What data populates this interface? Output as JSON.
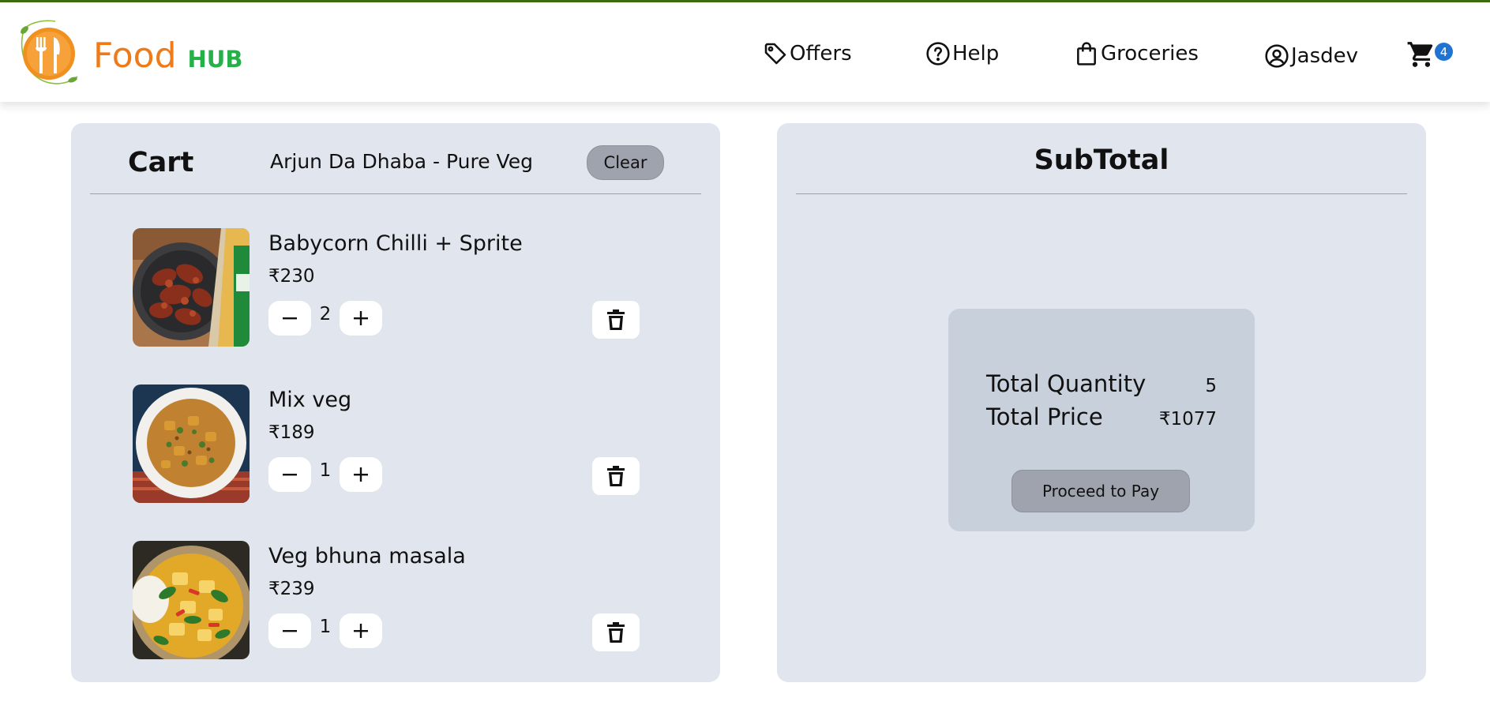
{
  "brand": {
    "name": "Food",
    "suffix": "HUB"
  },
  "nav": {
    "offers": "Offers",
    "help": "Help",
    "groceries": "Groceries",
    "user": "Jasdev",
    "cart_count": "4"
  },
  "cart": {
    "title": "Cart",
    "restaurant": "Arjun Da Dhaba - Pure Veg",
    "clear_label": "Clear",
    "items": [
      {
        "name": "Babycorn Chilli + Sprite",
        "price": "₹230",
        "quantity": "2"
      },
      {
        "name": "Mix veg",
        "price": "₹189",
        "quantity": "1"
      },
      {
        "name": "Veg bhuna masala",
        "price": "₹239",
        "quantity": "1"
      }
    ]
  },
  "subtotal": {
    "title": "SubTotal",
    "quantity_label": "Total Quantity",
    "quantity_value": "5",
    "price_label": "Total Price",
    "price_value": "₹1077",
    "pay_label": "Proceed to Pay"
  },
  "colors": {
    "brand_orange": "#ef7a1a",
    "brand_green": "#25b04a",
    "panel_bg": "#e1e6ee",
    "summary_bg": "#c8d0dc",
    "button_gray": "#9ea3ae",
    "badge_blue": "#1f73d1"
  },
  "icons": [
    "tag-icon",
    "help-circle-icon",
    "shopping-bag-icon",
    "user-circle-icon",
    "cart-icon",
    "minus-icon",
    "plus-icon",
    "trash-icon"
  ]
}
